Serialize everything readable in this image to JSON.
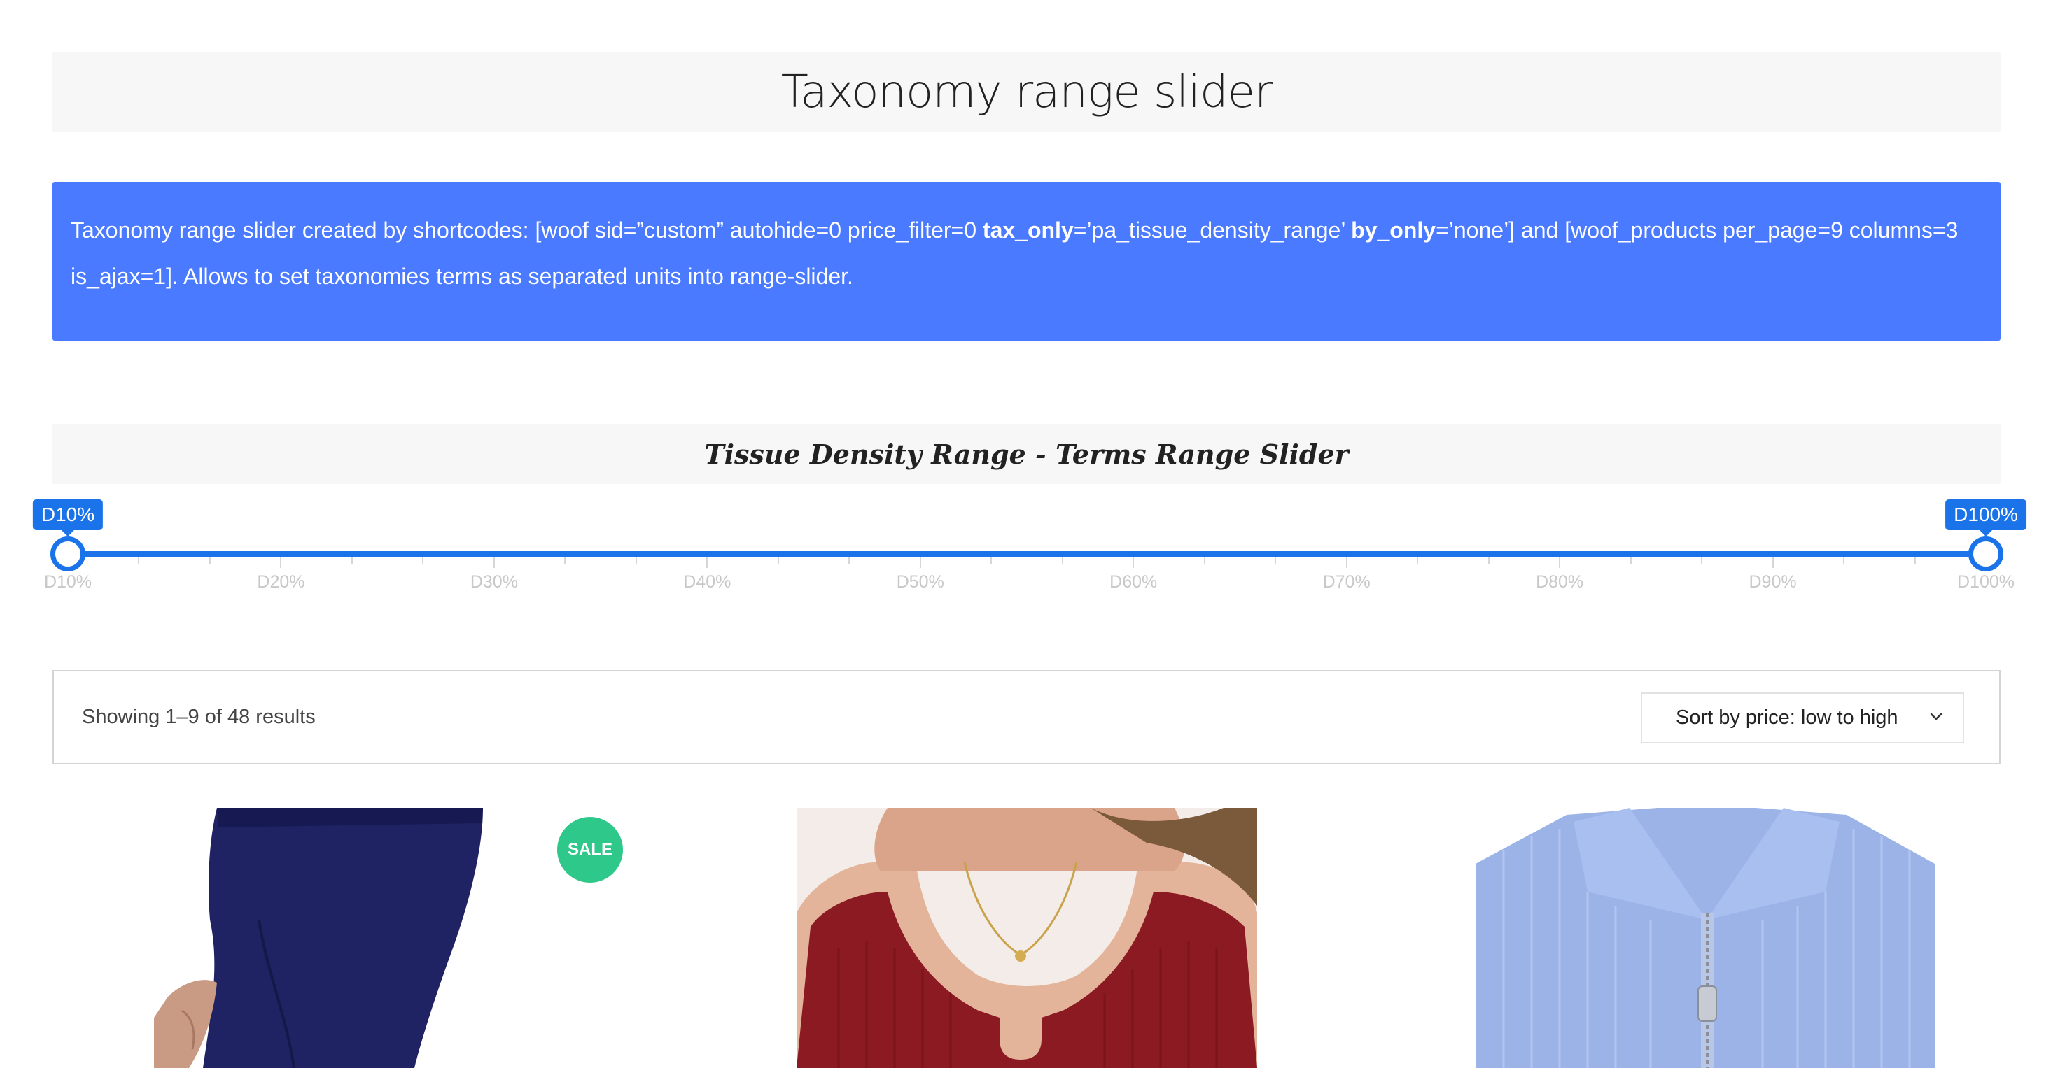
{
  "page": {
    "title": "Taxonomy range slider"
  },
  "info": {
    "text_1": "Taxonomy range slider created by shortcodes: [woof sid=”custom” autohide=0 price_filter=0 ",
    "bold_1": "tax_only",
    "text_2": "=’pa_tissue_density_range’ ",
    "bold_2": "by_only",
    "text_3": "=’none’] and [woof_products per_page=9 columns=3 is_ajax=1]. Allows to set taxonomies terms as separated units into range-slider."
  },
  "filter": {
    "heading": "Tissue Density Range - Terms Range Slider",
    "slider": {
      "min_label": "D10%",
      "max_label": "D100%",
      "selected_from_index": 0,
      "selected_to_index": 9,
      "terms": [
        "D10%",
        "D20%",
        "D30%",
        "D40%",
        "D50%",
        "D60%",
        "D70%",
        "D80%",
        "D90%",
        "D100%"
      ]
    }
  },
  "results": {
    "count_text": "Showing 1–9 of 48 results",
    "sort_selected": "Sort by price: low to high"
  },
  "products": {
    "badge": "SALE"
  },
  "colors": {
    "accent": "#1a73e8",
    "info_bg": "#4a7aff",
    "sale": "#2ec98a"
  }
}
